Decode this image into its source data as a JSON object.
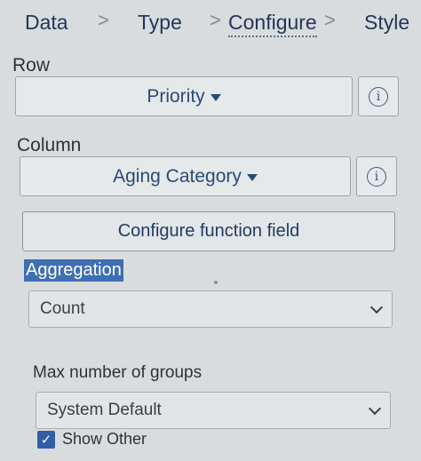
{
  "tabs": [
    {
      "label": "Data"
    },
    {
      "label": "Type"
    },
    {
      "label": "Configure"
    },
    {
      "label": "Style"
    }
  ],
  "separator_glyph": ">",
  "row": {
    "label": "Row",
    "selected": "Priority",
    "info_glyph": "i"
  },
  "column": {
    "label": "Column",
    "selected": "Aging Category",
    "info_glyph": "i"
  },
  "configure_function_field": {
    "label": "Configure function field"
  },
  "aggregation": {
    "label": "Aggregation",
    "selected": "Count"
  },
  "max_groups": {
    "label": "Max number of groups",
    "selected": "System Default"
  },
  "show_other": {
    "label": "Show Other",
    "checked": true,
    "check_glyph": "✓"
  },
  "colors": {
    "accent": "#2f5ea6",
    "highlight": "#3f6fb3",
    "link_text": "#2a4a78"
  }
}
